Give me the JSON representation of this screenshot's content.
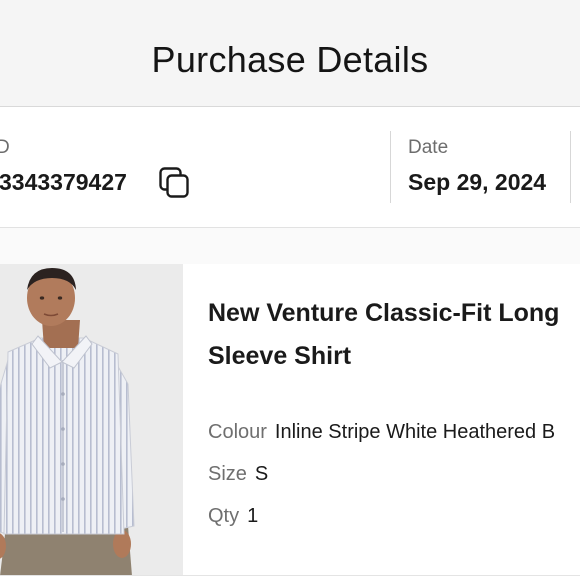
{
  "header": {
    "title": "Purchase Details"
  },
  "order": {
    "id_label": "D",
    "id_value": "3343379427",
    "date_label": "Date",
    "date_value": "Sep 29, 2024"
  },
  "product": {
    "title_line1": "New Venture Classic-Fit Long",
    "title_line2": "Sleeve Shirt",
    "attributes": [
      {
        "label": "Colour",
        "value": "Inline Stripe White Heathered B"
      },
      {
        "label": "Size",
        "value": "S"
      },
      {
        "label": "Qty",
        "value": "1"
      }
    ]
  },
  "icons": {
    "copy": "copy-icon"
  },
  "colors": {
    "background": "#f5f5f5",
    "text": "#1c1c1c",
    "muted": "#6d6d6d",
    "divider": "#d9d9d9"
  }
}
